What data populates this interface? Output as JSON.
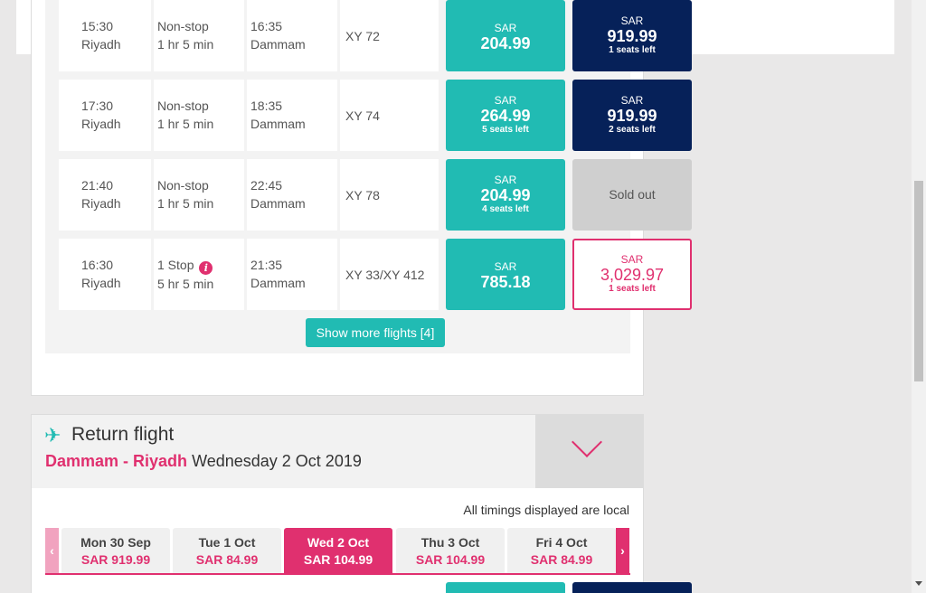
{
  "flights": [
    {
      "dep_time": "15:30",
      "dep_city": "Riyadh",
      "stops": "Non-stop",
      "duration": "1 hr 5 min",
      "arr_time": "16:35",
      "arr_city": "Dammam",
      "flight_no": "XY 72",
      "fare1": {
        "currency": "SAR",
        "amount": "204.99",
        "seats": ""
      },
      "fare2": {
        "currency": "SAR",
        "amount": "919.99",
        "seats": "1 seats left"
      }
    },
    {
      "dep_time": "17:30",
      "dep_city": "Riyadh",
      "stops": "Non-stop",
      "duration": "1 hr 5 min",
      "arr_time": "18:35",
      "arr_city": "Dammam",
      "flight_no": "XY 74",
      "fare1": {
        "currency": "SAR",
        "amount": "264.99",
        "seats": "5 seats left"
      },
      "fare2": {
        "currency": "SAR",
        "amount": "919.99",
        "seats": "2 seats left"
      }
    },
    {
      "dep_time": "21:40",
      "dep_city": "Riyadh",
      "stops": "Non-stop",
      "duration": "1 hr 5 min",
      "arr_time": "22:45",
      "arr_city": "Dammam",
      "flight_no": "XY 78",
      "fare1": {
        "currency": "SAR",
        "amount": "204.99",
        "seats": "4 seats left"
      },
      "fare2_status": "Sold out"
    },
    {
      "dep_time": "16:30",
      "dep_city": "Riyadh",
      "stops": "1 Stop",
      "duration": "5 hr 5 min",
      "arr_time": "21:35",
      "arr_city": "Dammam",
      "flight_no": "XY 33/XY 412",
      "fare1": {
        "currency": "SAR",
        "amount": "785.18",
        "seats": ""
      },
      "fare2": {
        "currency": "SAR",
        "amount": "3,029.97",
        "seats": "1 seats left"
      }
    }
  ],
  "show_more_label": "Show more flights [4]",
  "return": {
    "title": "Return flight",
    "route": "Dammam - Riyadh",
    "date": "Wednesday 2 Oct 2019",
    "timings_note": "All timings displayed are local",
    "days": [
      {
        "name": "Mon 30 Sep",
        "price": "SAR 919.99",
        "selected": false
      },
      {
        "name": "Tue 1 Oct",
        "price": "SAR 84.99",
        "selected": false
      },
      {
        "name": "Wed 2 Oct",
        "price": "SAR 104.99",
        "selected": true
      },
      {
        "name": "Thu 3 Oct",
        "price": "SAR 104.99",
        "selected": false
      },
      {
        "name": "Fri 4 Oct",
        "price": "SAR 84.99",
        "selected": false
      }
    ]
  },
  "info_icon_glyph": "i",
  "icons": [
    "info-icon",
    "plane-icon",
    "chevron-down-icon",
    "chevron-left-icon",
    "chevron-right-icon"
  ],
  "colors": {
    "teal": "#21bbb3",
    "navy": "#062159",
    "pink": "#e0306f"
  }
}
